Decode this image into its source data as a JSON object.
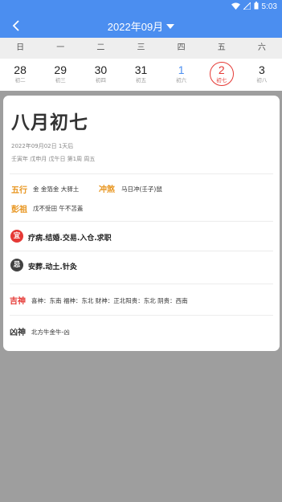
{
  "status": {
    "time": "5:03",
    "icons": [
      "wifi-icon",
      "signal-icon",
      "battery-icon"
    ]
  },
  "appbar": {
    "title": "2022年09月",
    "back_glyph": "‹"
  },
  "weekdays": [
    "日",
    "一",
    "二",
    "三",
    "四",
    "五",
    "六"
  ],
  "week": [
    {
      "num": "28",
      "lunar": "初二"
    },
    {
      "num": "29",
      "lunar": "初三"
    },
    {
      "num": "30",
      "lunar": "初四"
    },
    {
      "num": "31",
      "lunar": "初五"
    },
    {
      "num": "1",
      "lunar": "初六"
    },
    {
      "num": "2",
      "lunar": "初七"
    },
    {
      "num": "3",
      "lunar": "初八"
    }
  ],
  "detail": {
    "lunar_title": "八月初七",
    "gregorian": "2022年09月02日 1天后",
    "ganzhi": "壬寅年 戊申月 戊午日 第1周 周五",
    "wuxing_label": "五行",
    "wuxing_value": "金 金箔金 大驿土",
    "chongsha_label": "冲煞",
    "chongsha_value": "马日冲(壬子)鼠",
    "pengzu_label": "彭祖",
    "pengzu_value": "戊不受田 午不苫盖",
    "yi_badge": "宜",
    "yi_value": "疗病.结婚.交易.入仓.求职",
    "ji_badge": "忌",
    "ji_value": "安葬.动土.针灸",
    "jishen_label": "吉神",
    "jishen_value": "喜神：东南 福神：东北 财神：正北阳贵：东北 阴贵：西南",
    "xiongshen_label": "凶神",
    "xiongshen_value": "北方牛金牛-凶"
  },
  "colors": {
    "accent": "#4b8ef0",
    "selected": "#e53935",
    "label_orange": "#e8951e"
  }
}
